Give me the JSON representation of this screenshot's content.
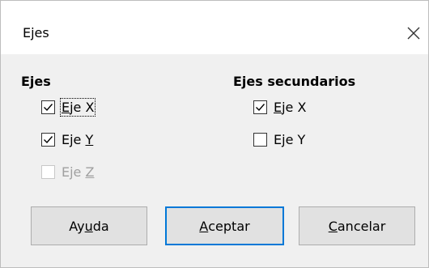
{
  "window": {
    "title": "Ejes"
  },
  "axes": {
    "heading": "Ejes",
    "items": [
      {
        "pre": "",
        "u": "E",
        "post": "je X",
        "checked": true,
        "enabled": true,
        "focused": true
      },
      {
        "pre": "Eje ",
        "u": "Y",
        "post": "",
        "checked": true,
        "enabled": true,
        "focused": false
      },
      {
        "pre": "Eje ",
        "u": "Z",
        "post": "",
        "checked": false,
        "enabled": false,
        "focused": false
      }
    ]
  },
  "secondary_axes": {
    "heading": "Ejes secundarios",
    "items": [
      {
        "pre": "",
        "u": "E",
        "post": "je X",
        "checked": true,
        "enabled": true
      },
      {
        "pre": "E",
        "u": "j",
        "post": "e Y",
        "checked": false,
        "enabled": true
      }
    ]
  },
  "buttons": {
    "help": {
      "pre": "Ay",
      "u": "u",
      "post": "da"
    },
    "ok": {
      "pre": "",
      "u": "A",
      "post": "ceptar"
    },
    "cancel": {
      "pre": "",
      "u": "C",
      "post": "ancelar"
    }
  },
  "colors": {
    "accent": "#0078d7",
    "dialog_bg": "#f0f0f0",
    "title_bg": "#ffffff"
  },
  "icons": {
    "close": "close-icon",
    "check": "check-icon"
  }
}
